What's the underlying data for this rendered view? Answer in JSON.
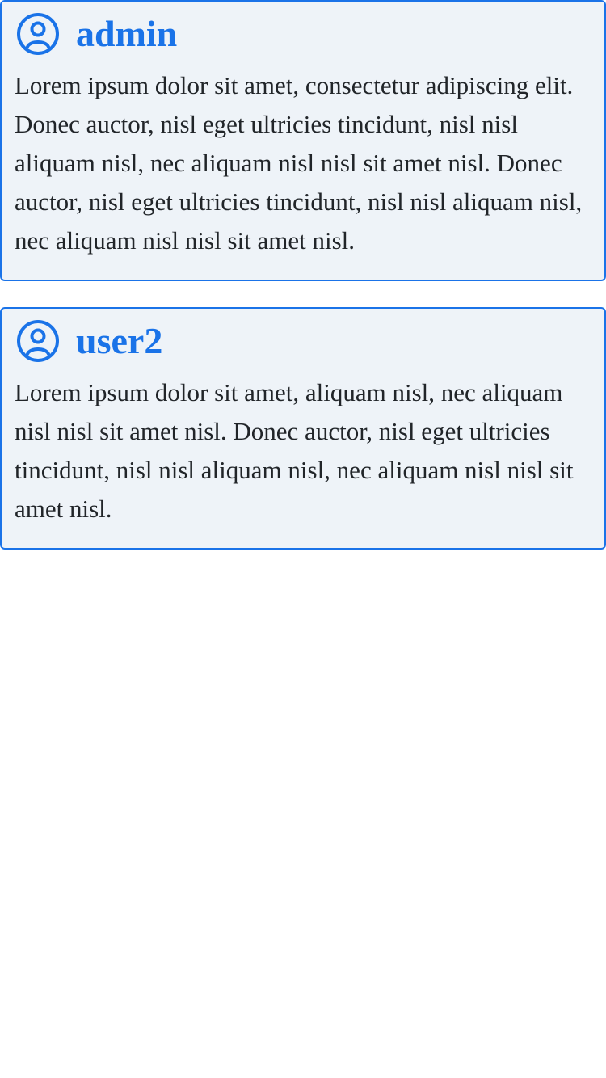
{
  "colors": {
    "accent": "#1a73e8",
    "card_background": "#eef3f8",
    "text": "#212529"
  },
  "posts": [
    {
      "avatar_icon": "user-circle-icon",
      "username": "admin",
      "message": "Lorem ipsum dolor sit amet, consectetur adipiscing elit. Donec auctor, nisl eget ultricies tincidunt, nisl nisl aliquam nisl, nec aliquam nisl nisl sit amet nisl. Donec auctor, nisl eget ultricies tincidunt, nisl nisl aliquam nisl, nec aliquam nisl nisl sit amet nisl."
    },
    {
      "avatar_icon": "user-circle-icon",
      "username": "user2",
      "message": "Lorem ipsum dolor sit amet, aliquam nisl, nec aliquam nisl nisl sit amet nisl. Donec auctor, nisl eget ultricies tincidunt, nisl nisl aliquam nisl, nec aliquam nisl nisl sit amet nisl."
    }
  ]
}
